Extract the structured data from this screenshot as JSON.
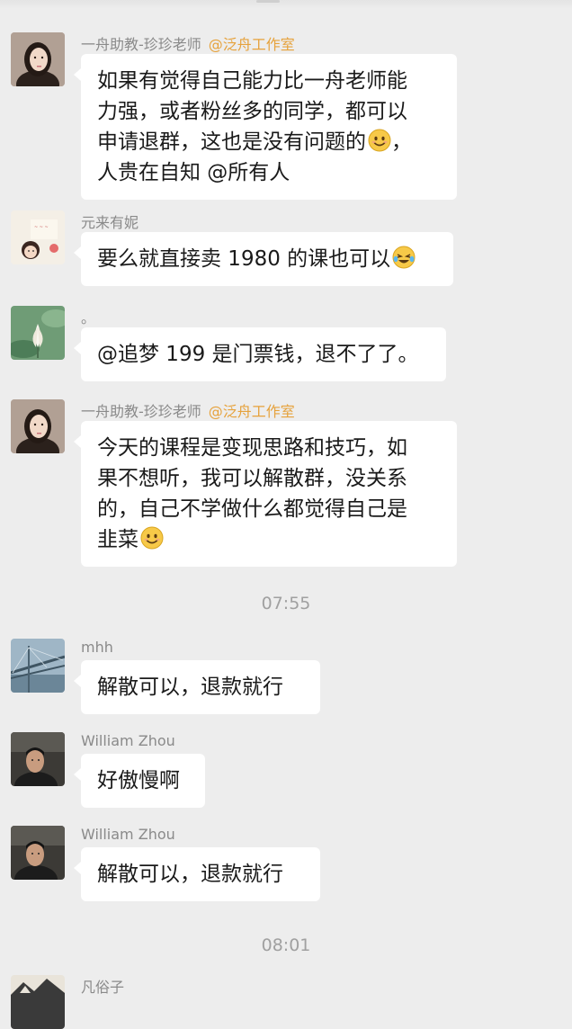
{
  "messages": [
    {
      "sender": "一舟助教-珍珍老师",
      "tag": "@泛舟工作室",
      "avatar": "woman-portrait-avatar",
      "lines": [
        "如果有觉得自己能力比一舟老师能",
        "力强，或者粉丝多的同学，都可以",
        "申请退群，这也是没有问题的",
        "人贵在自知 @所有人"
      ],
      "emoji_after_line": 2,
      "emoji": "smile-emoji"
    },
    {
      "sender": "元来有妮",
      "avatar": "cartoon-girl-avatar",
      "lines": [
        "要么就直接卖 1980 的课也可以"
      ],
      "emoji_after_line": 0,
      "emoji": "laughing-tears-emoji"
    },
    {
      "sender": "。",
      "avatar": "lotus-flower-avatar",
      "lines": [
        "@追梦 199 是门票钱，退不了了。"
      ]
    },
    {
      "sender": "一舟助教-珍珍老师",
      "tag": "@泛舟工作室",
      "avatar": "woman-portrait-avatar",
      "lines": [
        "今天的课程是变现思路和技巧，如",
        "果不想听，我可以解散群，没关系",
        "的，自己不学做什么都觉得自己是",
        "韭菜"
      ],
      "emoji_after_line": 3,
      "emoji": "smile-emoji"
    },
    {
      "sender": "mhh",
      "avatar": "bridge-photo-avatar",
      "lines": [
        "解散可以，退款就行"
      ]
    },
    {
      "sender": "William Zhou",
      "avatar": "man-photo-avatar",
      "lines": [
        "好傲慢啊"
      ]
    },
    {
      "sender": "William Zhou",
      "avatar": "man-photo-avatar",
      "lines": [
        "解散可以，退款就行"
      ]
    },
    {
      "sender": "凡俗子",
      "avatar": "landscape-avatar",
      "lines": []
    }
  ],
  "timestamps": [
    "07:55",
    "08:01"
  ],
  "colors": {
    "background": "#ededed",
    "bubble": "#ffffff",
    "sender_name": "#8a8a8a",
    "tag": "#e6a23c",
    "timestamp": "#a0a0a0"
  }
}
